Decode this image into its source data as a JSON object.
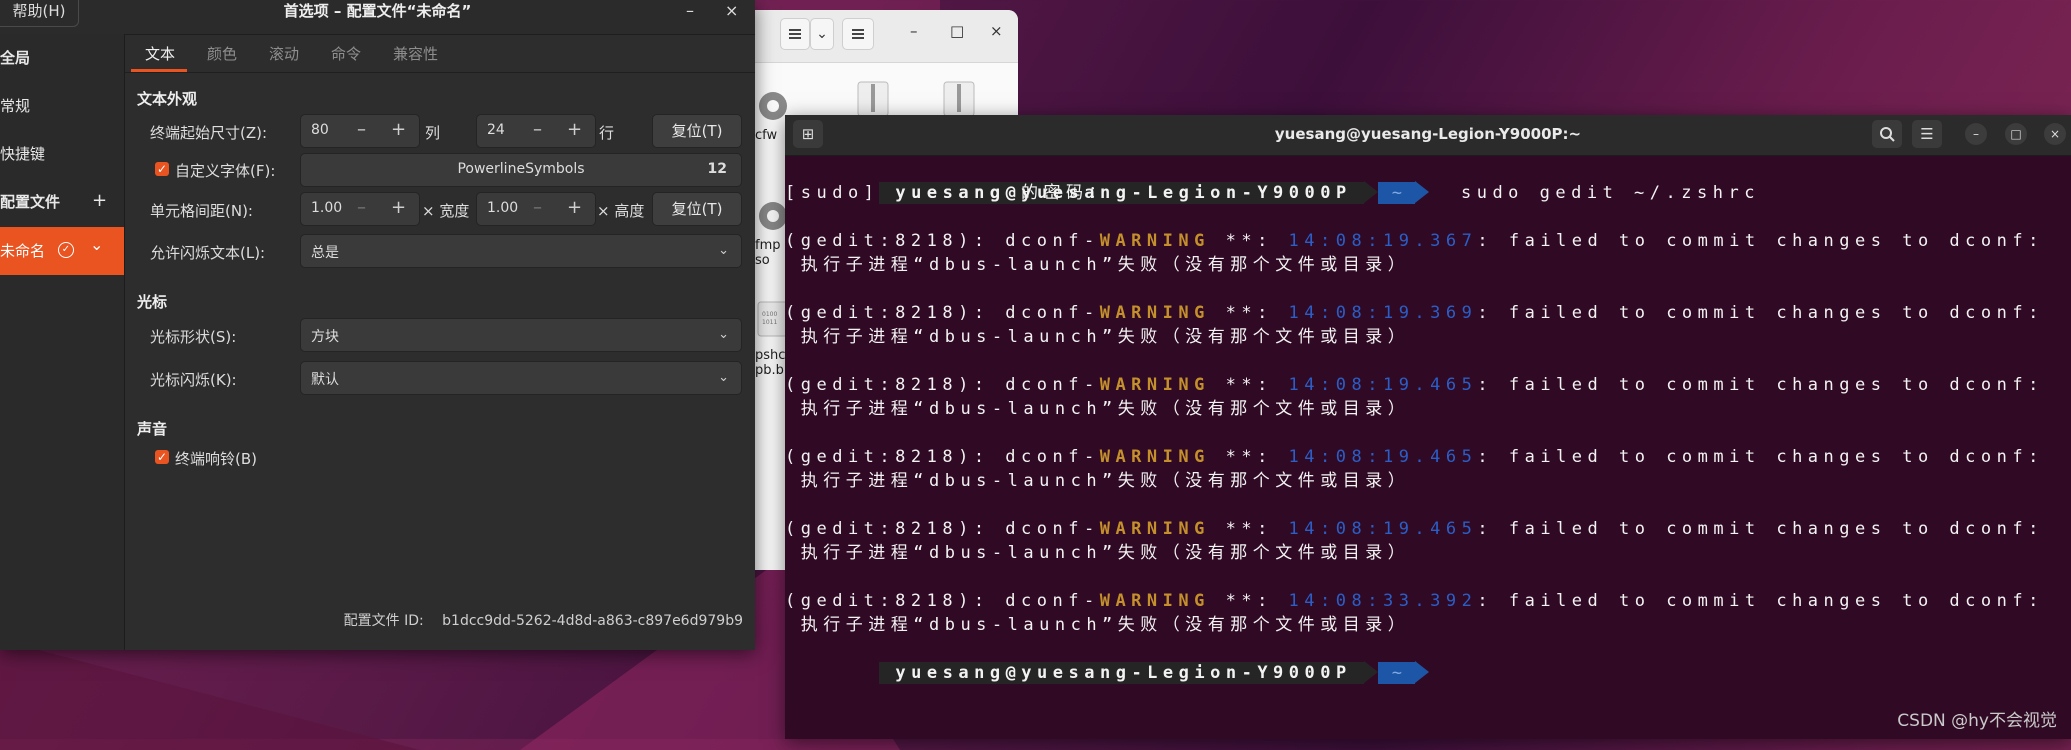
{
  "files": {
    "items": [
      {
        "label": "cfw"
      },
      {
        "label": "fmp\nso"
      },
      {
        "label": "pshc\npb.b"
      }
    ]
  },
  "prefs": {
    "menu_label": "帮助(H)",
    "title": "首选项 – 配置文件“未命名”",
    "minimize": "–",
    "close": "×",
    "sidebar": {
      "global": "全局",
      "general": "常规",
      "shortcuts": "快捷键",
      "profiles": "配置文件",
      "add": "+",
      "profile_name": "未命名",
      "check": "✓",
      "chevron": "⌄"
    },
    "tabs": [
      "文本",
      "颜色",
      "滚动",
      "命令",
      "兼容性"
    ],
    "text_appearance": "文本外观",
    "initial_size_label": "终端起始尺寸(Z):",
    "columns": "80",
    "columns_unit": "列",
    "rows": "24",
    "rows_unit": "行",
    "reset_label": "复位(T)",
    "custom_font_label": "自定义字体(F):",
    "font_name": "PowerlineSymbols",
    "font_size": "12",
    "cell_spacing_label": "单元格间距(N):",
    "width_value": "1.00",
    "width_label": "× 宽度",
    "height_value": "1.00",
    "height_label": "× 高度",
    "blink_text_label": "允许闪烁文本(L):",
    "blink_text_value": "总是",
    "cursor_section": "光标",
    "cursor_shape_label": "光标形状(S):",
    "cursor_shape_value": "方块",
    "cursor_blink_label": "光标闪烁(K):",
    "cursor_blink_value": "默认",
    "sound_section": "声音",
    "bell_label": "终端响铃(B)",
    "profile_id_label": "配置文件 ID:",
    "profile_id": "b1dcc9dd-5262-4d8d-a863-c897e6d979b9"
  },
  "terminal": {
    "title": "yuesang@yuesang-Legion-Y9000P:~",
    "prompt_user": "yuesang@yuesang-Legion-Y9000P",
    "prompt_dir": "~",
    "command": "sudo gedit ~/.zshrc",
    "sudo_prompt": "[sudo] yuesang 的密码：",
    "gedit_prefix": "(gedit:8218): dconf-",
    "warning": "WARNING",
    "stars": " **: ",
    "error_msg": ": failed to commit changes to dconf:",
    "error_line2": " 执行子进程“dbus-launch”失败（没有那个文件或目录）",
    "timestamps": [
      "14:08:19.367",
      "14:08:19.369",
      "14:08:19.465",
      "14:08:19.465",
      "14:08:19.465",
      "14:08:33.392"
    ]
  },
  "watermark": "CSDN @hy不会视觉"
}
